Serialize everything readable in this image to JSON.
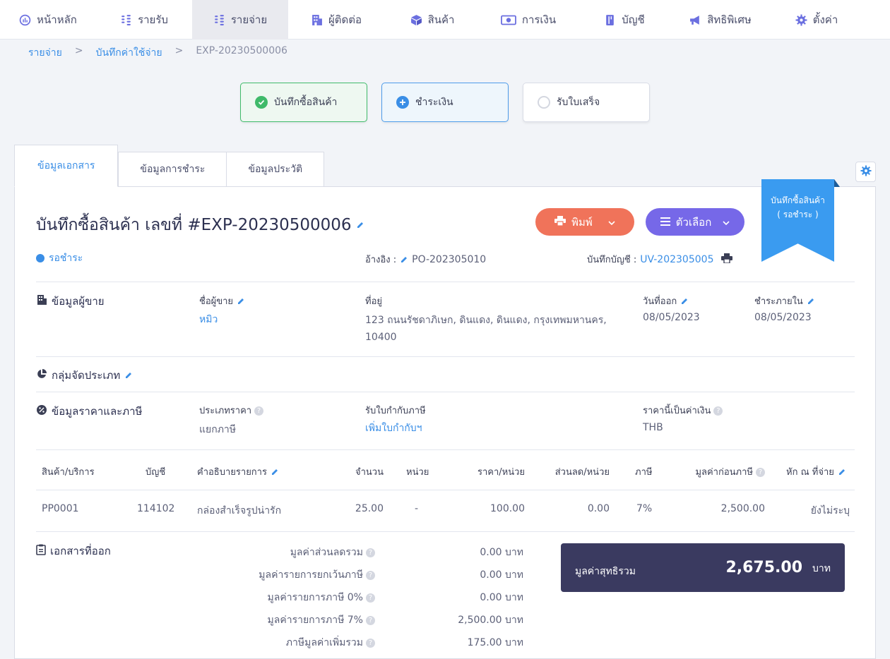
{
  "nav": [
    {
      "label": "หน้าหลัก",
      "icon": "dashboard-icon"
    },
    {
      "label": "รายรับ",
      "icon": "coins-icon"
    },
    {
      "label": "รายจ่าย",
      "icon": "coins-icon",
      "active": true
    },
    {
      "label": "ผู้ติดต่อ",
      "icon": "building-icon"
    },
    {
      "label": "สินค้า",
      "icon": "box-icon"
    },
    {
      "label": "การเงิน",
      "icon": "money-icon"
    },
    {
      "label": "บัญชี",
      "icon": "book-icon"
    },
    {
      "label": "สิทธิพิเศษ",
      "icon": "megaphone-icon"
    },
    {
      "label": "ตั้งค่า",
      "icon": "gear-icon"
    }
  ],
  "breadcrumb": {
    "level1": "รายจ่าย",
    "level2": "บันทึกค่าใช้จ่าย",
    "current": "EXP-20230500006",
    "sep": ">"
  },
  "steps": {
    "done": "บันทึกซื้อสินค้า",
    "current": "ชำระเงิน",
    "pending": "รับใบเสร็จ"
  },
  "tabs": {
    "doc": "ข้อมูลเอกสาร",
    "payment": "ข้อมูลการชำระ",
    "history": "ข้อมูลประวัติ"
  },
  "doc": {
    "title": "บันทึกซื้อสินค้า เลขที่ #EXP-20230500006",
    "print_label": "พิมพ์",
    "options_label": "ตัวเลือก",
    "ribbon_line1": "บันทึกซื้อสินค้า",
    "ribbon_line2": "( รอชำระ )",
    "status": "รอชำระ",
    "ref_label": "อ้างอิง :",
    "ref_value": "PO-202305010",
    "ledger_label": "บันทึกบัญชี :",
    "ledger_value": "UV-202305005"
  },
  "seller": {
    "section_title": "ข้อมูลผู้ขาย",
    "name_label": "ชื่อผู้ขาย",
    "name_value": "หมิว",
    "address_label": "ที่อยู่",
    "address_value": "123 ถนนรัชดาภิเษก, ดินแดง, ดินแดง, กรุงเทพมหานคร, 10400",
    "issue_label": "วันที่ออก",
    "issue_value": "08/05/2023",
    "due_label": "ชำระภายใน",
    "due_value": "08/05/2023"
  },
  "category": {
    "section_title": "กลุ่มจัดประเภท"
  },
  "pricing": {
    "section_title": "ข้อมูลราคาและภาษี",
    "price_type_label": "ประเภทราคา",
    "price_type_value": "แยกภาษี",
    "tax_invoice_label": "รับใบกำกับภาษี",
    "tax_invoice_value": "เพิ่มใบกำกับฯ",
    "currency_label": "ราคานี้เป็นค่าเงิน",
    "currency_value": "THB"
  },
  "table": {
    "headers": {
      "product": "สินค้า/บริการ",
      "account": "บัญชี",
      "desc": "คำอธิบายรายการ",
      "qty": "จำนวน",
      "unit": "หน่วย",
      "price": "ราคา/หน่วย",
      "discount": "ส่วนลด/หน่วย",
      "tax": "ภาษี",
      "pretax": "มูลค่าก่อนภาษี",
      "wht": "หัก ณ ที่จ่าย"
    },
    "row": {
      "product": "PP0001",
      "account": "114102",
      "desc": "กล่องสำเร็จรูปน่ารัก",
      "qty": "25.00",
      "unit": "-",
      "price": "100.00",
      "discount": "0.00",
      "tax": "7%",
      "pretax": "2,500.00",
      "wht": "ยังไม่ระบุ"
    }
  },
  "docs_out": {
    "section_title": "เอกสารที่ออก"
  },
  "summary": [
    {
      "label": "มูลค่าส่วนลดรวม",
      "value": "0.00 บาท"
    },
    {
      "label": "มูลค่ารายการยกเว้นภาษี",
      "value": "0.00 บาท"
    },
    {
      "label": "มูลค่ารายการภาษี 0%",
      "value": "0.00 บาท"
    },
    {
      "label": "มูลค่ารายการภาษี 7%",
      "value": "2,500.00 บาท"
    },
    {
      "label": "ภาษีมูลค่าเพิ่มรวม",
      "value": "175.00 บาท"
    }
  ],
  "total": {
    "label": "มูลค่าสุทธิรวม",
    "value": "2,675.00",
    "unit": "บาท"
  },
  "colors": {
    "accent": "#3a8ee6",
    "print": "#f0735a",
    "options": "#7668e8",
    "ribbon": "#3a9bf0",
    "total_bg": "#3a3a60",
    "success": "#3fba6a"
  }
}
